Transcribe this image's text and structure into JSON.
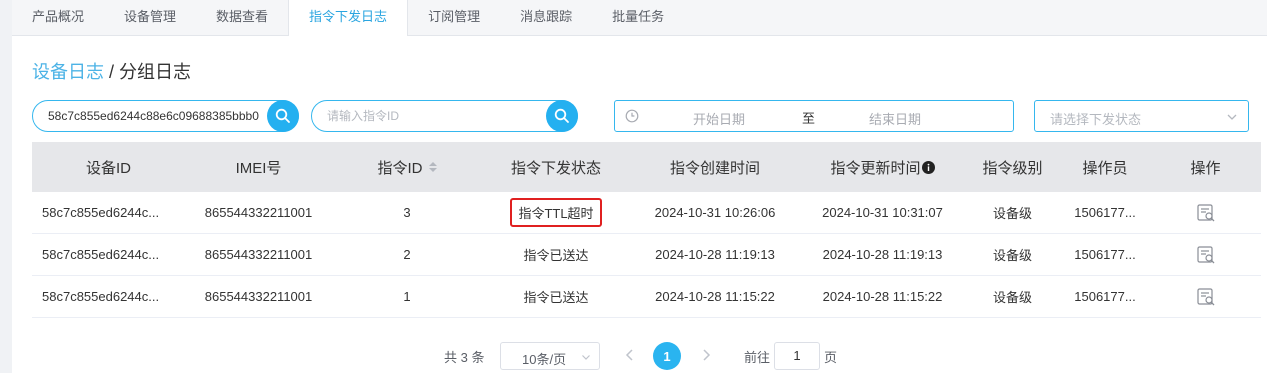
{
  "tabs": [
    "产品概况",
    "设备管理",
    "数据查看",
    "指令下发日志",
    "订阅管理",
    "消息跟踪",
    "批量任务"
  ],
  "breadcrumb": {
    "parent": "设备日志",
    "separator": " / ",
    "current": "分组日志"
  },
  "filters": {
    "device_search_value": "58c7c855ed6244c88e6c09688385bbb0",
    "command_search_placeholder": "请输入指令ID",
    "date_start": "开始日期",
    "date_separator": "至",
    "date_end": "结束日期",
    "status_placeholder": "请选择下发状态"
  },
  "table": {
    "headers": [
      "设备ID",
      "IMEI号",
      "指令ID",
      "指令下发状态",
      "指令创建时间",
      "指令更新时间",
      "指令级别",
      "操作员",
      "操作"
    ],
    "rows": [
      {
        "device_id": "58c7c855ed6244c...",
        "imei": "865544332211001",
        "command_id": "3",
        "status": "指令TTL超时",
        "created": "2024-10-31 10:26:06",
        "updated": "2024-10-31 10:31:07",
        "level": "设备级",
        "operator": "1506177..."
      },
      {
        "device_id": "58c7c855ed6244c...",
        "imei": "865544332211001",
        "command_id": "2",
        "status": "指令已送达",
        "created": "2024-10-28 11:19:13",
        "updated": "2024-10-28 11:19:13",
        "level": "设备级",
        "operator": "1506177..."
      },
      {
        "device_id": "58c7c855ed6244c...",
        "imei": "865544332211001",
        "command_id": "1",
        "status": "指令已送达",
        "created": "2024-10-28 11:15:22",
        "updated": "2024-10-28 11:15:22",
        "level": "设备级",
        "operator": "1506177..."
      }
    ]
  },
  "pagination": {
    "total": "共 3 条",
    "page_size": "10条/页",
    "current_page": "1",
    "goto_label": "前往",
    "goto_value": "1",
    "page_suffix": "页"
  },
  "colors": {
    "accent": "#24b0f0",
    "highlight_border": "#e02020"
  },
  "icons": [
    "search-icon",
    "clock-icon",
    "chevron-down-icon",
    "info-icon",
    "sort-icon",
    "view-log-icon",
    "chevron-left-icon",
    "chevron-right-icon"
  ]
}
